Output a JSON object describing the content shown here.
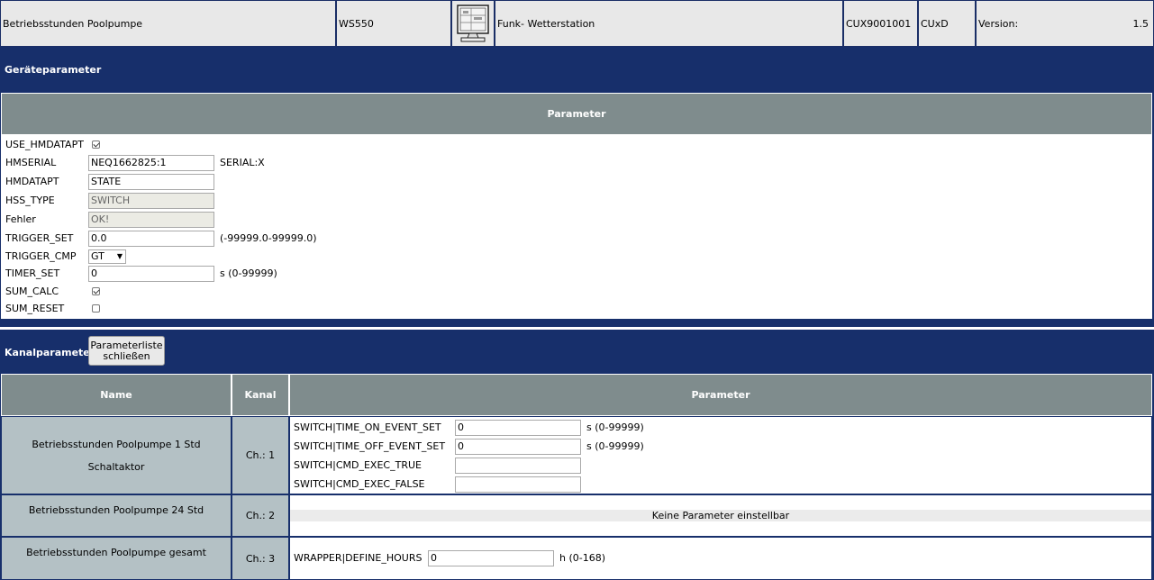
{
  "header": {
    "device_name": "Betriebsstunden Poolpumpe",
    "model": "WS550",
    "image_icon": "device-monitor-icon",
    "description": "Funk- Wetterstation",
    "serial": "CUX9001001",
    "interface": "CUxD",
    "version_label": "Version:",
    "version_value": "1.5"
  },
  "device_params": {
    "section_title": "Geräteparameter",
    "table_header": "Parameter",
    "rows": [
      {
        "label": "USE_HMDATAPT",
        "type": "checkbox",
        "checked": true
      },
      {
        "label": "HMSERIAL",
        "type": "text",
        "value": "NEQ1662825:1",
        "suffix": "SERIAL:X"
      },
      {
        "label": "HMDATAPT",
        "type": "text",
        "value": "STATE"
      },
      {
        "label": "HSS_TYPE",
        "type": "text-disabled",
        "value": "SWITCH"
      },
      {
        "label": "Fehler",
        "type": "text-disabled",
        "value": "OK!"
      },
      {
        "label": "TRIGGER_SET",
        "type": "text",
        "value": "0.0",
        "suffix": "(-99999.0-99999.0)"
      },
      {
        "label": "TRIGGER_CMP",
        "type": "select",
        "value": "GT"
      },
      {
        "label": "TIMER_SET",
        "type": "text",
        "value": "0",
        "suffix": "s (0-99999)"
      },
      {
        "label": "SUM_CALC",
        "type": "checkbox",
        "checked": true
      },
      {
        "label": "SUM_RESET",
        "type": "checkbox",
        "checked": false
      }
    ]
  },
  "channel_params": {
    "section_title": "Kanalparameter",
    "close_button_line1": "Parameterliste",
    "close_button_line2": "schließen",
    "col_name": "Name",
    "col_channel": "Kanal",
    "col_params": "Parameter",
    "ch1": {
      "name_line1": "Betriebsstunden Poolpumpe 1 Std",
      "name_line2": "Schaltaktor",
      "channel": "Ch.: 1",
      "params": [
        {
          "label": "SWITCH|TIME_ON_EVENT_SET",
          "value": "0",
          "suffix": "s (0-99999)"
        },
        {
          "label": "SWITCH|TIME_OFF_EVENT_SET",
          "value": "0",
          "suffix": "s (0-99999)"
        },
        {
          "label": "SWITCH|CMD_EXEC_TRUE",
          "value": "",
          "suffix": ""
        },
        {
          "label": "SWITCH|CMD_EXEC_FALSE",
          "value": "",
          "suffix": ""
        }
      ]
    },
    "ch2": {
      "name": "Betriebsstunden Poolpumpe 24 Std",
      "channel": "Ch.: 2",
      "no_params": "Keine Parameter einstellbar"
    },
    "ch3": {
      "name": "Betriebsstunden Poolpumpe gesamt",
      "channel": "Ch.: 3",
      "param_label": "WRAPPER|DEFINE_HOURS",
      "param_value": "0",
      "param_suffix": "h (0-168)"
    }
  }
}
